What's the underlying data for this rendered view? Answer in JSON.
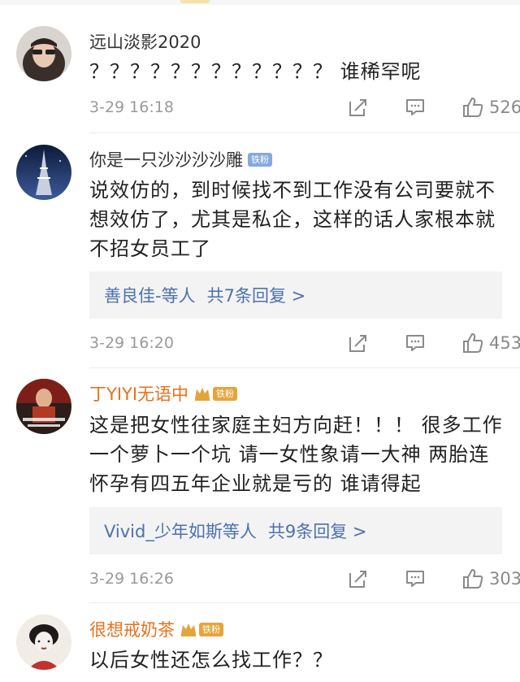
{
  "comments": [
    {
      "user": "远山淡影2020",
      "text": "？？？？？？？？？？？？ 谁稀罕呢",
      "time": "3-29 16:18",
      "likes": "526"
    },
    {
      "user": "你是一只沙沙沙沙雕",
      "badge": "铁粉",
      "text": "说效仿的，到时候找不到工作没有公司要就不想效仿了，尤其是私企，这样的话人家根本就不招女员工了",
      "reply_names": "善良佳-等人",
      "reply_count": "共7条回复 >",
      "time": "3-29 16:20",
      "likes": "453"
    },
    {
      "user": "丁YIYI无语中",
      "badge": "铁粉",
      "text": "这是把女性往家庭主妇方向赶！！！ 很多工作一个萝卜一个坑  请一女性象请一大神 两胎连怀孕有四五年企业就是亏的   谁请得起",
      "reply_names": "Vivid_少年如斯等人",
      "reply_count": "共9条回复 >",
      "time": "3-29 16:26",
      "likes": "303"
    },
    {
      "user": "很想戒奶茶",
      "badge": "铁粉",
      "text": "以后女性还怎么找工作？？"
    }
  ],
  "colors": {
    "vip_name": "#e8701c",
    "link": "#4c72ad",
    "badge_blue": "#86a9dd",
    "badge_gold": "#e5a43b",
    "meta_gray": "#9a9a9a"
  },
  "icons": {
    "share": "share-icon",
    "comment": "comment-icon",
    "like": "thumbs-up-icon",
    "vip": "crown-icon"
  }
}
